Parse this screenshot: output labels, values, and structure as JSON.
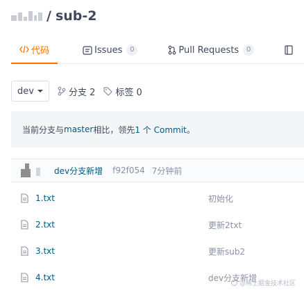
{
  "repo": {
    "separator": "/",
    "name": "sub-2"
  },
  "tabs": [
    {
      "label": "代码",
      "icon": "code-icon",
      "active": true
    },
    {
      "label": "Issues",
      "icon": "issues-icon",
      "count": "0"
    },
    {
      "label": "Pull Requests",
      "icon": "pull-request-icon",
      "count": "0"
    },
    {
      "label": "",
      "icon": "wiki-icon"
    }
  ],
  "toolbar": {
    "branch": "dev",
    "branches_label": "分支 2",
    "tags_label": "标签 0"
  },
  "compare": {
    "prefix": "当前分支与 ",
    "base": "master",
    "middle": " 相比，领先 ",
    "ahead": "1 个 Commit",
    "suffix": "。"
  },
  "last_commit": {
    "message": "dev分支新增",
    "sha": "f92f054",
    "time": "7分钟前"
  },
  "files": [
    {
      "name": "1.txt",
      "commit": "初始化"
    },
    {
      "name": "2.txt",
      "commit": "更新2txt"
    },
    {
      "name": "3.txt",
      "commit": "更新sub2"
    },
    {
      "name": "4.txt",
      "commit": "dev分支新增"
    }
  ],
  "watermark": "@稀土掘金技术社区",
  "colors": {
    "accent": "#fe7300",
    "link": "#005980",
    "muted": "#8c92a4",
    "text": "#40485b"
  }
}
